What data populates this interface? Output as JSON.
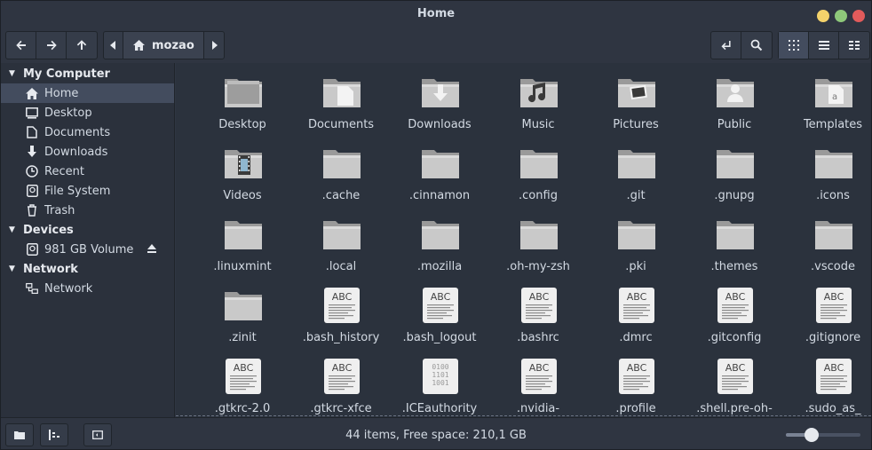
{
  "window": {
    "title": "Home"
  },
  "toolbar": {
    "breadcrumb": "mozao"
  },
  "sidebar": {
    "sections": [
      {
        "label": "My Computer",
        "items": [
          {
            "label": "Home",
            "icon": "home-icon",
            "active": true
          },
          {
            "label": "Desktop",
            "icon": "desktop-icon"
          },
          {
            "label": "Documents",
            "icon": "documents-icon"
          },
          {
            "label": "Downloads",
            "icon": "download-icon"
          },
          {
            "label": "Recent",
            "icon": "recent-icon"
          },
          {
            "label": "File System",
            "icon": "filesystem-icon"
          },
          {
            "label": "Trash",
            "icon": "trash-icon"
          }
        ]
      },
      {
        "label": "Devices",
        "items": [
          {
            "label": "981 GB Volume",
            "icon": "drive-icon",
            "eject": true
          }
        ]
      },
      {
        "label": "Network",
        "items": [
          {
            "label": "Network",
            "icon": "network-icon"
          }
        ]
      }
    ]
  },
  "files": [
    {
      "name": "Desktop",
      "type": "desktop-folder"
    },
    {
      "name": "Documents",
      "type": "documents-folder"
    },
    {
      "name": "Downloads",
      "type": "downloads-folder"
    },
    {
      "name": "Music",
      "type": "music-folder"
    },
    {
      "name": "Pictures",
      "type": "pictures-folder"
    },
    {
      "name": "Public",
      "type": "public-folder"
    },
    {
      "name": "Templates",
      "type": "templates-folder"
    },
    {
      "name": "Videos",
      "type": "videos-folder"
    },
    {
      "name": ".cache",
      "type": "folder"
    },
    {
      "name": ".cinnamon",
      "type": "folder"
    },
    {
      "name": ".config",
      "type": "folder"
    },
    {
      "name": ".git",
      "type": "folder"
    },
    {
      "name": ".gnupg",
      "type": "folder"
    },
    {
      "name": ".icons",
      "type": "folder"
    },
    {
      "name": ".linuxmint",
      "type": "folder"
    },
    {
      "name": ".local",
      "type": "folder"
    },
    {
      "name": ".mozilla",
      "type": "folder"
    },
    {
      "name": ".oh-my-zsh",
      "type": "folder"
    },
    {
      "name": ".pki",
      "type": "folder"
    },
    {
      "name": ".themes",
      "type": "folder"
    },
    {
      "name": ".vscode",
      "type": "folder"
    },
    {
      "name": ".zinit",
      "type": "folder"
    },
    {
      "name": ".bash_history",
      "type": "text"
    },
    {
      "name": ".bash_logout",
      "type": "text"
    },
    {
      "name": ".bashrc",
      "type": "text"
    },
    {
      "name": ".dmrc",
      "type": "text"
    },
    {
      "name": ".gitconfig",
      "type": "text"
    },
    {
      "name": ".gitignore",
      "type": "text"
    },
    {
      "name": ".gtkrc-2.0",
      "type": "text"
    },
    {
      "name": ".gtkrc-xfce",
      "type": "text"
    },
    {
      "name": ".ICEauthority",
      "type": "binary"
    },
    {
      "name": ".nvidia-",
      "type": "text"
    },
    {
      "name": ".profile",
      "type": "text"
    },
    {
      "name": ".shell.pre-oh-",
      "type": "text"
    },
    {
      "name": ".sudo_as_",
      "type": "text"
    }
  ],
  "text_icon_label": "ABC",
  "binary_icon_lines": [
    "0100",
    "1101",
    "1001"
  ],
  "status": {
    "text": "44 items, Free space: 210,1 GB",
    "zoom_fraction": 0.34
  },
  "colors": {
    "folder": "#c9c9c9",
    "folder_dark": "#9a9a9a",
    "accent_active": "#434c5e"
  }
}
